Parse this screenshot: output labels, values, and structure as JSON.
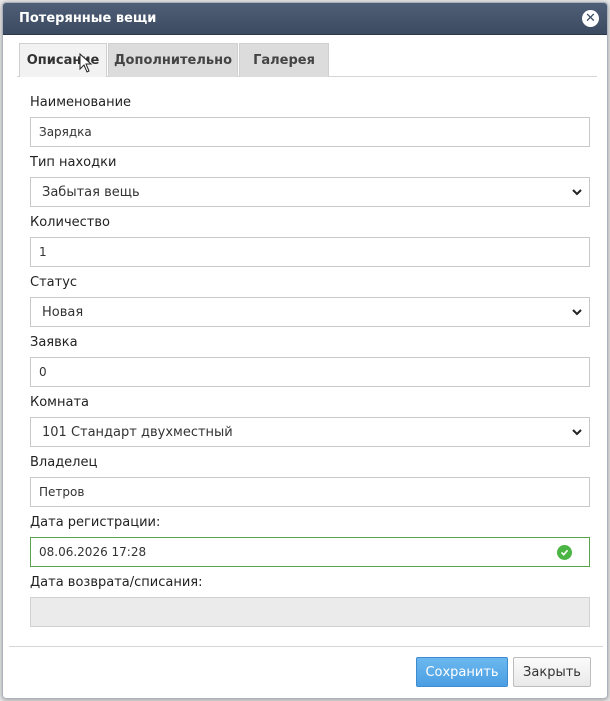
{
  "dialog": {
    "title": "Потерянные вещи"
  },
  "tabs": [
    {
      "label": "Описание"
    },
    {
      "label": "Дополнительно"
    },
    {
      "label": "Галерея"
    }
  ],
  "form": {
    "name": {
      "label": "Наименование",
      "value": "Зарядка"
    },
    "type": {
      "label": "Тип находки",
      "value": "Забытая вещь"
    },
    "quantity": {
      "label": "Количество",
      "value": "1"
    },
    "status": {
      "label": "Статус",
      "value": "Новая"
    },
    "request": {
      "label": "Заявка",
      "value": "0"
    },
    "room": {
      "label": "Комната",
      "value": "101 Стандарт двухместный"
    },
    "owner": {
      "label": "Владелец",
      "value": "Петров"
    },
    "reg_date": {
      "label": "Дата регистрации:",
      "value": "08.06.2026 17:28"
    },
    "return_date": {
      "label": "Дата возврата/списания:",
      "value": ""
    }
  },
  "buttons": {
    "save": "Сохранить",
    "close": "Закрыть"
  },
  "colors": {
    "titlebar": "#3b4a60",
    "accent": "#4b9ee3",
    "valid": "#4bb543"
  }
}
